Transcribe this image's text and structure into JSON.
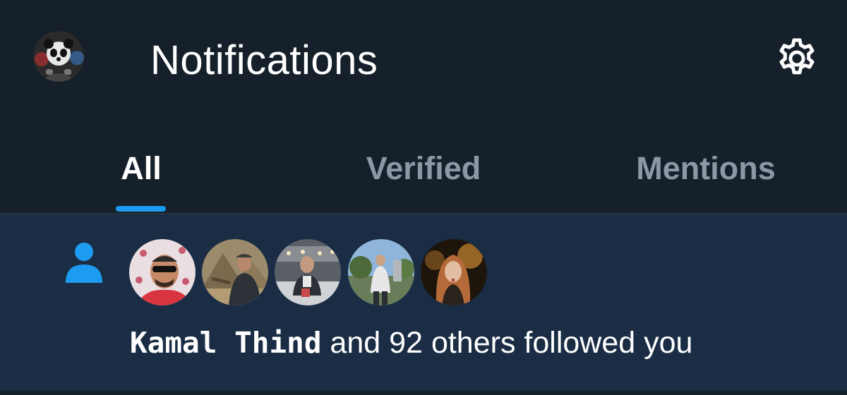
{
  "header": {
    "title": "Notifications",
    "profile_avatar_icon": "panda-avatar",
    "settings_icon": "gear-icon"
  },
  "tabs": [
    {
      "label": "All",
      "active": true
    },
    {
      "label": "Verified",
      "active": false
    },
    {
      "label": "Mentions",
      "active": false
    }
  ],
  "notification": {
    "type_icon": "person-icon",
    "actor": "Kamal Thind",
    "message": " and 92 others followed you",
    "follower_avatar_count": 5
  },
  "colors": {
    "background": "#15202b",
    "notification_bg": "#1a2d44",
    "accent": "#1d9bf0",
    "inactive_tab": "#8b98a5",
    "text": "#ffffff"
  }
}
